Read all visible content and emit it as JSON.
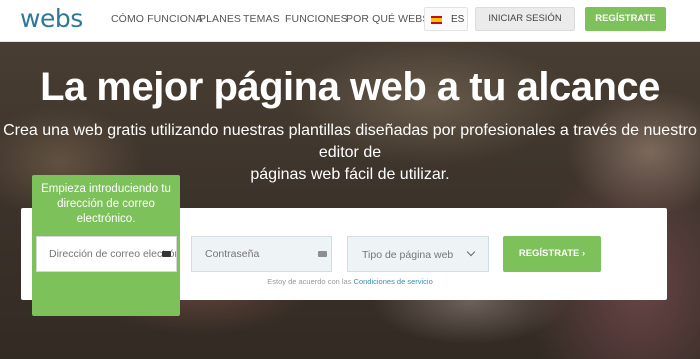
{
  "header": {
    "logo": "webs",
    "nav": [
      "CÓMO FUNCIONA",
      "PLANES",
      "TEMAS",
      "FUNCIONES",
      "POR QUÉ WEBS"
    ],
    "language": "ES",
    "login_label": "INICIAR SESIÓN",
    "register_label": "REGÍSTRATE"
  },
  "hero": {
    "title": "La mejor página web a tu alcance",
    "subtitle_line1": "Crea una web gratis utilizando nuestras plantillas diseñadas por profesionales a través de nuestro editor de",
    "subtitle_line2": "páginas web fácil de utilizar."
  },
  "signup": {
    "tooltip": "Empieza introduciendo tu dirección de correo electrónico.",
    "email_placeholder": "Dirección de correo electrónico",
    "password_placeholder": "Contraseña",
    "site_type_label": "Tipo de página web",
    "submit_label": "REGÍSTRATE ›",
    "terms_prefix": "Estoy de acuerdo con las ",
    "terms_link": "Condiciones de servicio"
  },
  "colors": {
    "brand_green": "#7dc15a",
    "logo_blue": "#2e7a96"
  }
}
